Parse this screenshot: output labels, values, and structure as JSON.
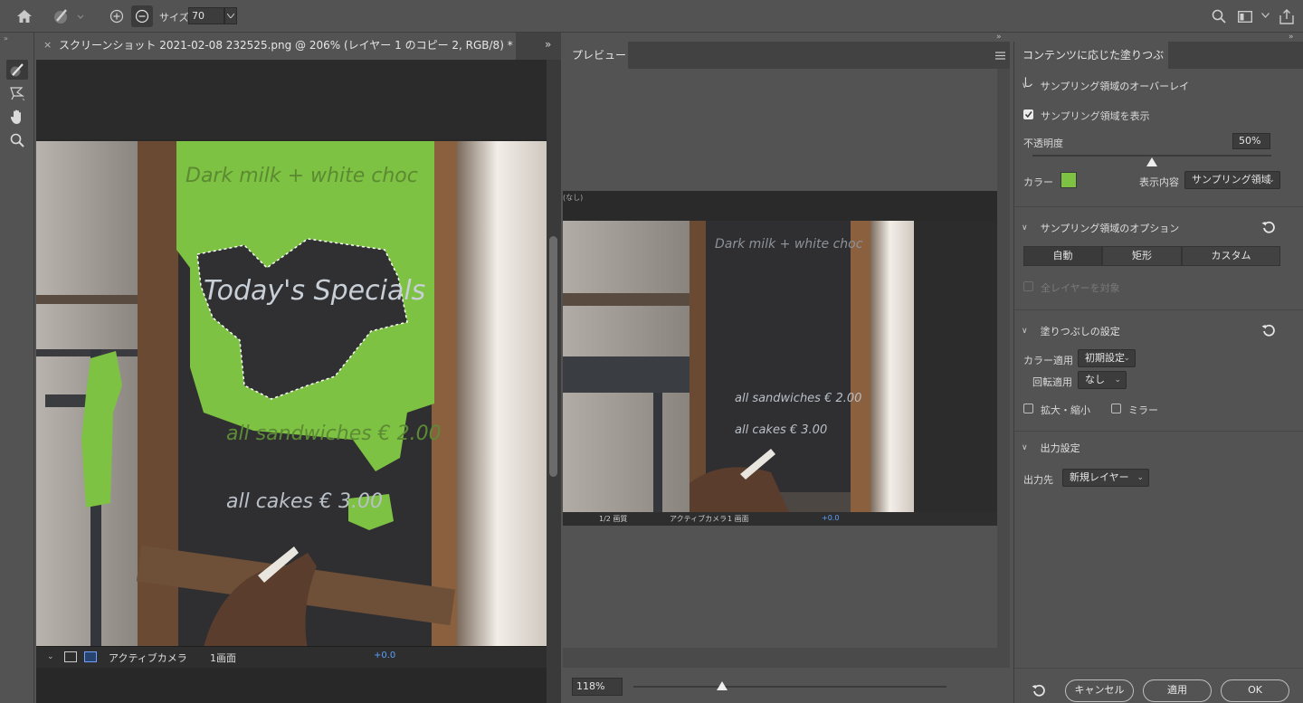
{
  "toolbar_top": {
    "size_label": "サイズ",
    "size_value": "70"
  },
  "document": {
    "tab_title": "スクリーンショット 2021-02-08 232525.png @ 206% (レイヤー 1 のコピー 2, RGB/8) *",
    "image_text": {
      "line1": "Dark milk + white choc",
      "line2": "Today's Specials",
      "line3": "all sandwiches € 2.00",
      "line4": "all cakes € 3.00"
    },
    "inner_bar": {
      "camera": "アクティブカメラ",
      "view": "1画面",
      "offset": "+0.0"
    }
  },
  "preview": {
    "tab_label": "プレビュー",
    "zoom": "118%",
    "inner_label": "(なし)",
    "inner_bar": {
      "res": "1/2 画質",
      "camera": "アクティブカメラ",
      "view": "1 画面",
      "offset": "+0.0"
    }
  },
  "panel": {
    "title": "コンテンツに応じた塗りつぶし",
    "overlay_section": "サンプリング領域のオーバーレイ",
    "show_sampling": "サンプリング領域を表示",
    "opacity_label": "不透明度",
    "opacity_value": "50%",
    "opacity_fraction": 0.5,
    "color_label": "カラー",
    "color_swatch": "#7dc242",
    "display_label": "表示内容",
    "display_value": "サンプリング領域",
    "options_section": "サンプリング領域のオプション",
    "mode_auto": "自動",
    "mode_rect": "矩形",
    "mode_custom": "カスタム",
    "all_layers": "全レイヤーを対象",
    "fill_section": "塗りつぶしの設定",
    "color_adapt_label": "カラー適用",
    "color_adapt_value": "初期設定",
    "rotate_label": "回転適用",
    "rotate_value": "なし",
    "scale_label": "拡大・縮小",
    "mirror_label": "ミラー",
    "output_section": "出力設定",
    "output_label": "出力先",
    "output_value": "新規レイヤー",
    "cancel": "キャンセル",
    "apply": "適用",
    "ok": "OK"
  },
  "colors": {
    "overlay_green": "#7dc242",
    "chalkboard": "#2f2f32",
    "frame_wood": "#6b4a33"
  }
}
